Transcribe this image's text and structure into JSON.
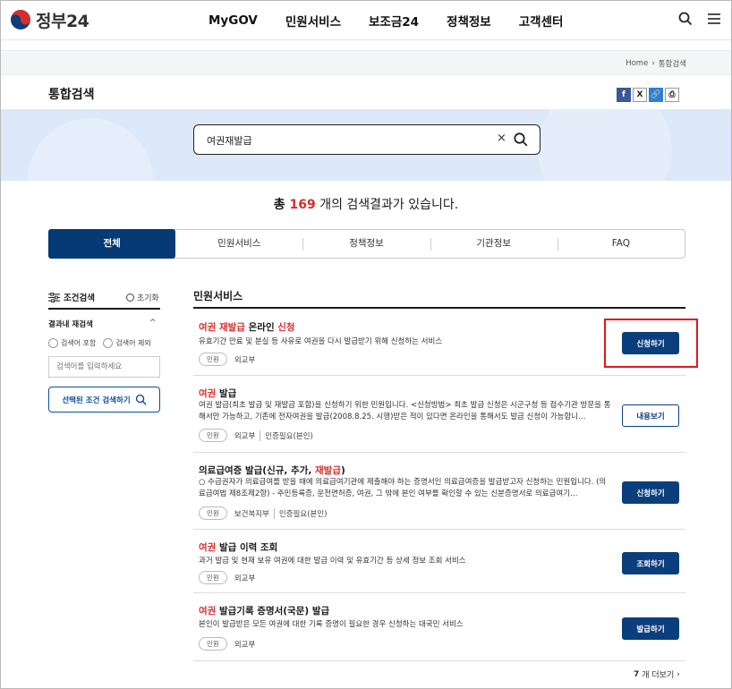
{
  "header": {
    "logo_text": "정부24",
    "nav": [
      "MyGOV",
      "민원서비스",
      "보조금24",
      "정책정보",
      "고객센터"
    ]
  },
  "breadcrumb": {
    "home": "Home",
    "separator": "›",
    "current": "통합검색"
  },
  "page_title": "통합검색",
  "share": {
    "facebook": "f",
    "x": "X",
    "link": "🔗",
    "print": "⎙"
  },
  "search": {
    "value": "여권재발급",
    "clear": "×"
  },
  "result_count": {
    "prefix": "총 ",
    "number": "169",
    "suffix": " 개의 검색결과가 있습니다."
  },
  "tabs": [
    "전체",
    "민원서비스",
    "정책정보",
    "기관정보",
    "FAQ"
  ],
  "filter": {
    "title": "조건검색",
    "reset": "초기화",
    "refine_title": "결과내 재검색",
    "chevron": "^",
    "include_label": "검색어 포함",
    "exclude_label": "검색어 제외",
    "input_placeholder": "검색어를 입력하세요",
    "apply_label": "선택된 조건 검색하기"
  },
  "section_title": "민원서비스",
  "results": [
    {
      "title_parts": [
        [
          "여권 재발급",
          true
        ],
        [
          " 온라인 ",
          false
        ],
        [
          "신청",
          true
        ]
      ],
      "desc": "유효기간 만료 및 분실 등 사유로 여권을 다시 발급받기 위해 신청하는 서비스",
      "badge": "민원",
      "agency": "외교부",
      "extra": "",
      "button": "신청하기",
      "button_style": "solid"
    },
    {
      "title_parts": [
        [
          "여권",
          true
        ],
        [
          " 발급",
          false
        ]
      ],
      "desc": "여권 발급(최초 발급 및 재발급 포함)을 신청하기 위한 민원입니다. <신청방법> 최초 발급 신청은 시군구청 등 접수기관 방문을 통해서만 가능하고, 기존에 전자여권을 발급(2008.8.25. 시행)받은 적이 있다면 온라인을 통해서도 발급 신청이 가능합니…",
      "badge": "민원",
      "agency": "외교부",
      "extra": "인증필요(본인)",
      "button": "내용보기",
      "button_style": "outline"
    },
    {
      "title_parts": [
        [
          "의료급여증 발급(신규, 추가, ",
          false
        ],
        [
          "재발급",
          true
        ],
        [
          ")",
          false
        ]
      ],
      "desc": "○ 수급권자가 의료급여를 받을 때에 의료급여기관에 제출해야 하는 증명서인 의료급여증을 발급받고자 신청하는 민원입니다. (의료급여법 제8조제2항) - 주민등록증, 운전면허증, 여권, 그 밖에 본인 여부를 확인할 수 있는 신분증명서로 의료급여기…",
      "badge": "민원",
      "agency": "보건복지부",
      "extra": "인증필요(본인)",
      "button": "신청하기",
      "button_style": "solid"
    },
    {
      "title_parts": [
        [
          "여권",
          true
        ],
        [
          " 발급 이력 조회",
          false
        ]
      ],
      "desc": "과거 발급 및 현재 보유 여권에 대한 발급 이력 및 유효기간 등 상세 정보 조회 서비스",
      "badge": "민원",
      "agency": "외교부",
      "extra": "",
      "button": "조회하기",
      "button_style": "solid"
    },
    {
      "title_parts": [
        [
          "여권",
          true
        ],
        [
          " 발급기록 증명서(국문) 발급",
          false
        ]
      ],
      "desc": "본인이 발급받은 모든 여권에 대한 기록 증명이 필요한 경우 신청하는 대국민 서비스",
      "badge": "민원",
      "agency": "외교부",
      "extra": "",
      "button": "발급하기",
      "button_style": "solid"
    }
  ],
  "more": {
    "count": "7",
    "label": "개 더보기",
    "chevron": "›"
  },
  "colors": {
    "primary": "#0b3e7c",
    "highlight": "#d62d2d",
    "annotation": "#e0161e"
  }
}
